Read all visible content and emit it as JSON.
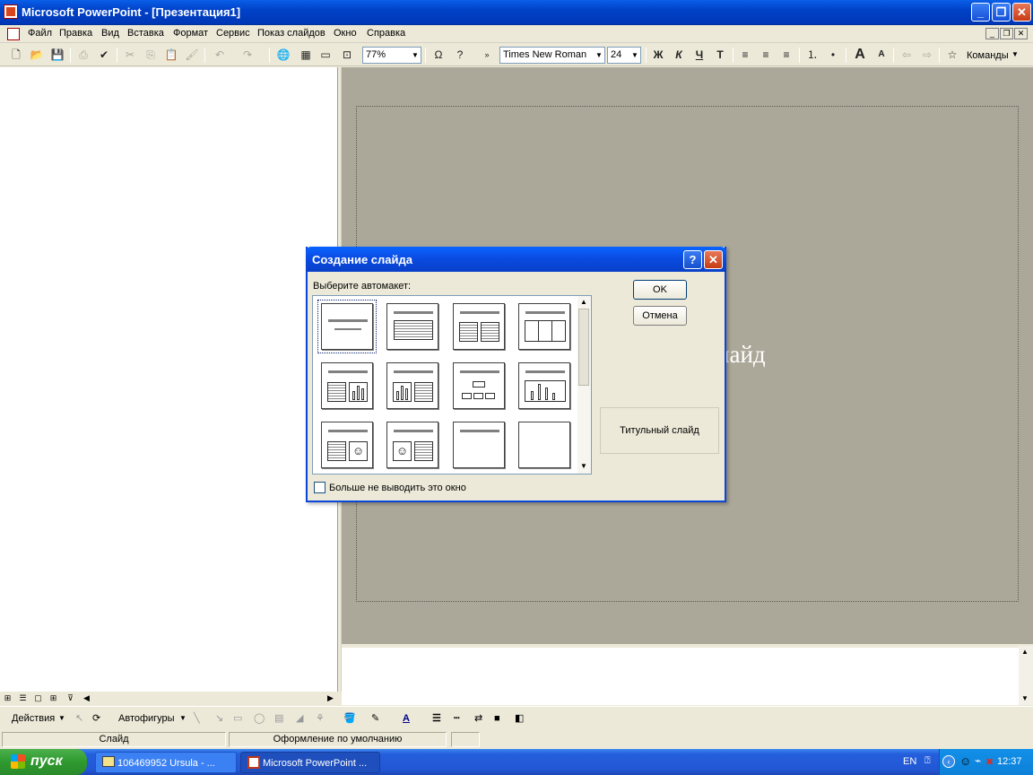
{
  "window": {
    "title": "Microsoft PowerPoint - [Презентация1]"
  },
  "menubar": {
    "items": [
      "Файл",
      "Правка",
      "Вид",
      "Вставка",
      "Формат",
      "Сервис",
      "Показ слайдов",
      "Окно",
      "Справка"
    ]
  },
  "toolbar": {
    "zoom": "77%",
    "font_name": "Times New Roman",
    "font_size": "24",
    "bold_label": "Ж",
    "italic_label": "К",
    "underline_label": "Ч",
    "shadow_label": "Т",
    "commands_label": "Команды"
  },
  "slide": {
    "visible_text": "лайд"
  },
  "dialog": {
    "title": "Создание слайда",
    "prompt": "Выберите автомакет:",
    "ok_label": "OK",
    "cancel_label": "Отмена",
    "selected_layout_name": "Титульный слайд",
    "checkbox_label": "Больше не выводить это окно",
    "checkbox_checked": false
  },
  "drawbar": {
    "actions_label": "Действия",
    "autoshapes_label": "Автофигуры"
  },
  "statusbar": {
    "slide": "Слайд",
    "design": "Оформление по умолчанию"
  },
  "taskbar": {
    "start_label": "пуск",
    "tasks": [
      "106469952 Ursula - ...",
      "Microsoft PowerPoint ..."
    ],
    "lang": "EN",
    "clock": "12:37"
  },
  "colors": {
    "titlebar_blue": "#0a5fe8",
    "slide_bg": "#aca899",
    "start_green": "#3c9e3c"
  }
}
